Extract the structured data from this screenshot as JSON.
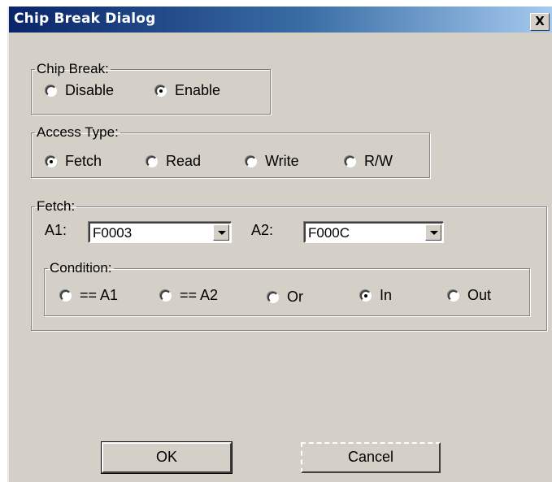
{
  "window": {
    "title": "Chip Break Dialog",
    "close_label": "X"
  },
  "chip_break": {
    "legend": "Chip Break:",
    "options": [
      {
        "label": "Disable",
        "checked": false
      },
      {
        "label": "Enable",
        "checked": true
      }
    ]
  },
  "access_type": {
    "legend": "Access Type:",
    "options": [
      {
        "label": "Fetch",
        "checked": true
      },
      {
        "label": "Read",
        "checked": false
      },
      {
        "label": "Write",
        "checked": false
      },
      {
        "label": "R/W",
        "checked": false
      }
    ]
  },
  "fetch": {
    "legend": "Fetch:",
    "a1_label": "A1:",
    "a1_value": "F0003",
    "a2_label": "A2:",
    "a2_value": "F000C",
    "condition": {
      "legend": "Condition:",
      "options": [
        {
          "label": "== A1",
          "checked": false
        },
        {
          "label": "== A2",
          "checked": false
        },
        {
          "label": "Or",
          "checked": false
        },
        {
          "label": "In",
          "checked": true
        },
        {
          "label": "Out",
          "checked": false
        }
      ]
    }
  },
  "buttons": {
    "ok": "OK",
    "cancel": "Cancel"
  }
}
